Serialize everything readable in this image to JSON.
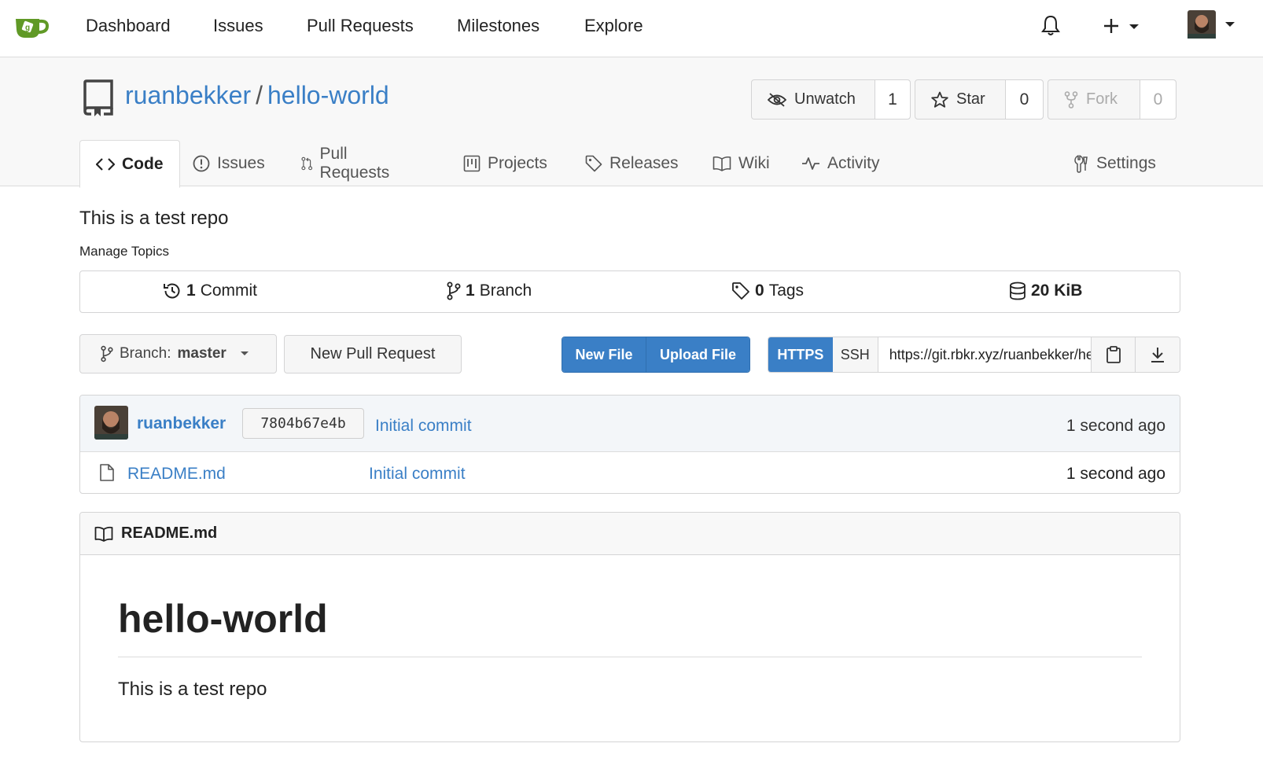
{
  "nav": {
    "items": [
      "Dashboard",
      "Issues",
      "Pull Requests",
      "Milestones",
      "Explore"
    ],
    "plus_label": "+"
  },
  "repo": {
    "owner": "ruanbekker",
    "separator": "/",
    "name": "hello-world",
    "watch": {
      "label": "Unwatch",
      "count": "1"
    },
    "star": {
      "label": "Star",
      "count": "0"
    },
    "fork": {
      "label": "Fork",
      "count": "0"
    }
  },
  "tabs": {
    "code": "Code",
    "issues": "Issues",
    "pulls": "Pull Requests",
    "projects": "Projects",
    "releases": "Releases",
    "wiki": "Wiki",
    "activity": "Activity",
    "settings": "Settings"
  },
  "description": "This is a test repo",
  "manage_topics": "Manage Topics",
  "stats": {
    "commits_count": "1",
    "commits_label": "Commit",
    "branches_count": "1",
    "branches_label": "Branch",
    "tags_count": "0",
    "tags_label": "Tags",
    "size": "20 KiB"
  },
  "toolbar": {
    "branch_prefix": "Branch:",
    "branch_name": "master",
    "new_pr": "New Pull Request",
    "new_file": "New File",
    "upload_file": "Upload File",
    "https": "HTTPS",
    "ssh": "SSH",
    "clone_url": "https://git.rbkr.xyz/ruanbekker/hello-world.git"
  },
  "latest_commit": {
    "author": "ruanbekker",
    "sha": "7804b67e4b",
    "message": "Initial commit",
    "time": "1 second ago"
  },
  "files": [
    {
      "name": "README.md",
      "message": "Initial commit",
      "time": "1 second ago"
    }
  ],
  "readme": {
    "filename": "README.md",
    "heading": "hello-world",
    "body": "This is a test repo"
  },
  "colors": {
    "accent": "#3a7fc6",
    "logo": "#609926"
  }
}
